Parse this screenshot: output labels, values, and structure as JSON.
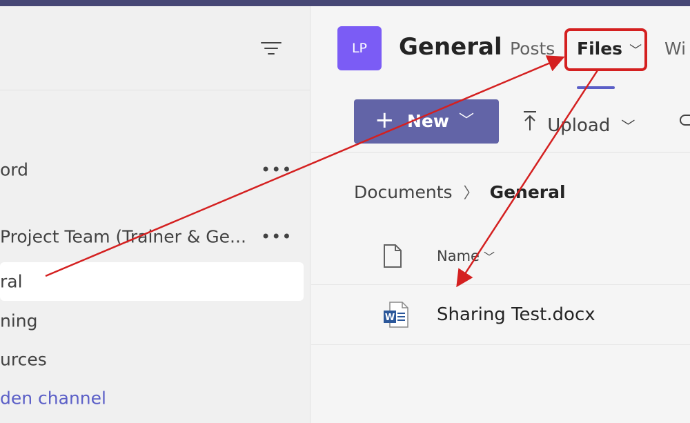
{
  "sidebar": {
    "channels": [
      {
        "label": "ord",
        "has_more": true,
        "more_label": "•••"
      },
      {
        "label": "Project Team (Trainer & Ge...",
        "has_more": true,
        "more_label": "•••"
      },
      {
        "label": "ral",
        "selected": true
      },
      {
        "label": "ning"
      },
      {
        "label": "urces"
      },
      {
        "label": "den channel",
        "link": true
      }
    ]
  },
  "header": {
    "avatar_initials": "LP",
    "title": "General",
    "tabs": [
      {
        "label": "Posts"
      },
      {
        "label": "Files",
        "active": true
      },
      {
        "label": "Wi"
      }
    ]
  },
  "toolbar": {
    "new_label": "New",
    "upload_label": "Upload"
  },
  "breadcrumb": {
    "root": "Documents",
    "current": "General"
  },
  "file_list": {
    "column_name": "Name",
    "files": [
      {
        "name": "Sharing Test.docx",
        "icon": "word-doc-icon"
      }
    ]
  },
  "colors": {
    "accent": "#6264a7",
    "avatar": "#7b5cf5",
    "annotation": "#d42020",
    "topbar": "#464775"
  }
}
